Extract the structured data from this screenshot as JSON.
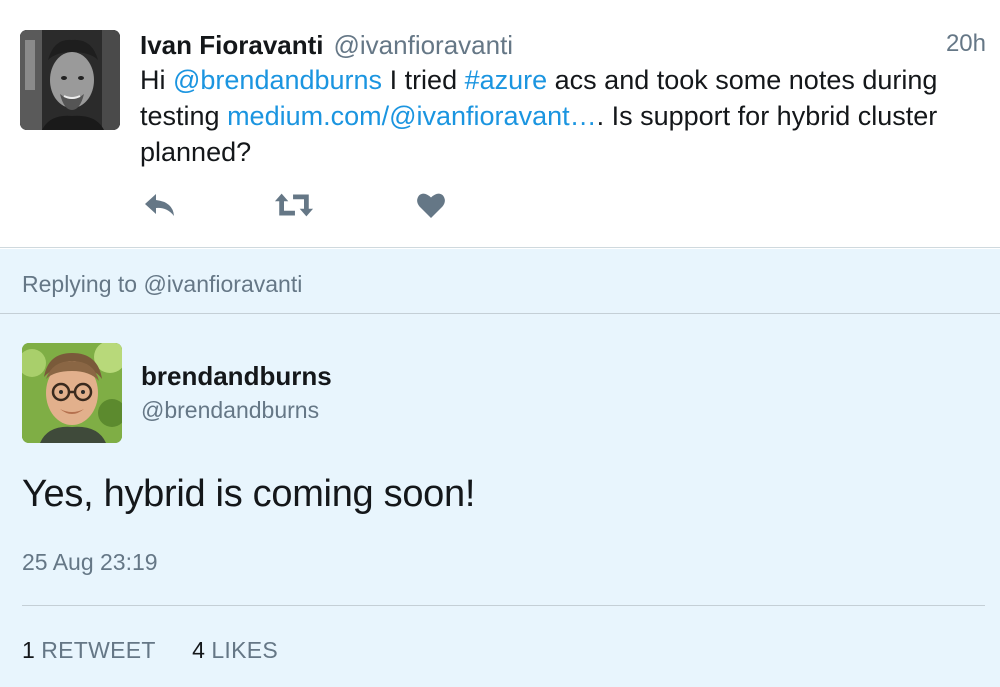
{
  "parent_tweet": {
    "fullname": "Ivan Fioravanti",
    "screen_name": "@ivanfioravanti",
    "timestamp": "20h",
    "text": {
      "hi": "Hi ",
      "mention": "@brendandburns",
      "after_mention": " I tried ",
      "hashtag": "#azure",
      "after_hashtag": " acs and took some notes during testing ",
      "link": "medium.com/@ivanfioravant…",
      "after_link": ". Is support for hybrid cluster planned?"
    },
    "actions": {
      "reply_icon": "reply-icon",
      "retweet_icon": "retweet-icon",
      "like_icon": "heart-icon"
    }
  },
  "reply_context": {
    "replying_to": "Replying to @ivanfioravanti"
  },
  "reply_tweet": {
    "name": "brendandburns",
    "handle": "@brendandburns",
    "text": "Yes, hybrid is coming soon!",
    "date": "25 Aug 23:19",
    "stats": {
      "retweets_count": "1",
      "retweets_label": "RETWEET",
      "likes_count": "4",
      "likes_label": "LIKES"
    }
  },
  "colors": {
    "link": "#1b95e0",
    "secondary_text": "#657786",
    "reply_background": "#e8f5fd"
  }
}
